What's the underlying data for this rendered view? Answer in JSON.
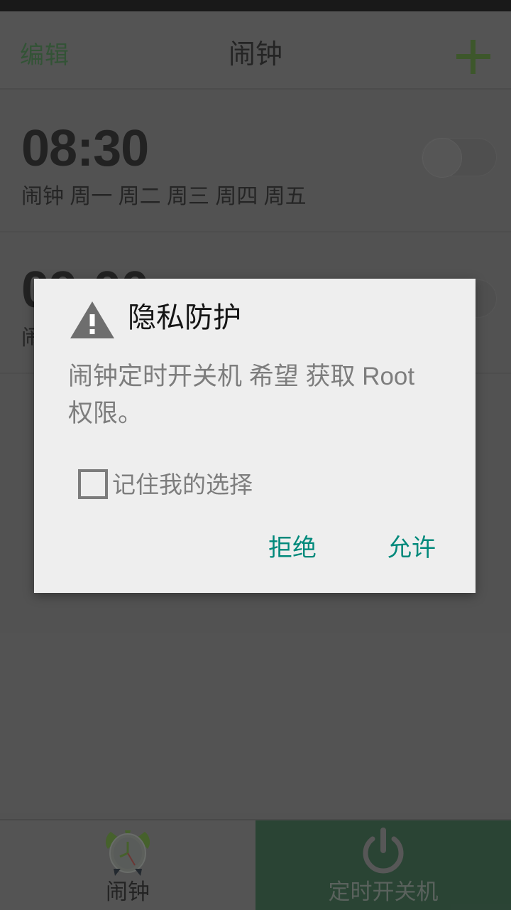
{
  "app": {
    "screen_title": "闹钟"
  },
  "action_bar": {
    "edit_label": "编辑",
    "add_icon": "plus-icon",
    "accent_color": "#3e6b20"
  },
  "alarms": [
    {
      "time": "08:30",
      "label": "闹钟 周一 周二 周三 周四 周五",
      "enabled": false
    },
    {
      "time": "09:00",
      "label": "闹钟",
      "enabled": false
    }
  ],
  "dialog": {
    "icon": "warning-triangle-icon",
    "title": "隐私防护",
    "message": "闹钟定时开关机 希望 获取 Root 权限。",
    "checkbox_label": "记住我的选择",
    "checkbox_checked": false,
    "deny_label": "拒绝",
    "allow_label": "允许",
    "button_color": "#00897b",
    "background_color": "#eeeeee"
  },
  "tab_bar": {
    "tabs": [
      {
        "label": "闹钟",
        "icon": "alarm-clock-icon",
        "selected": false
      },
      {
        "label": "定时开关机",
        "icon": "power-icon",
        "selected": true
      }
    ],
    "selected_color": "#1e4a30"
  }
}
